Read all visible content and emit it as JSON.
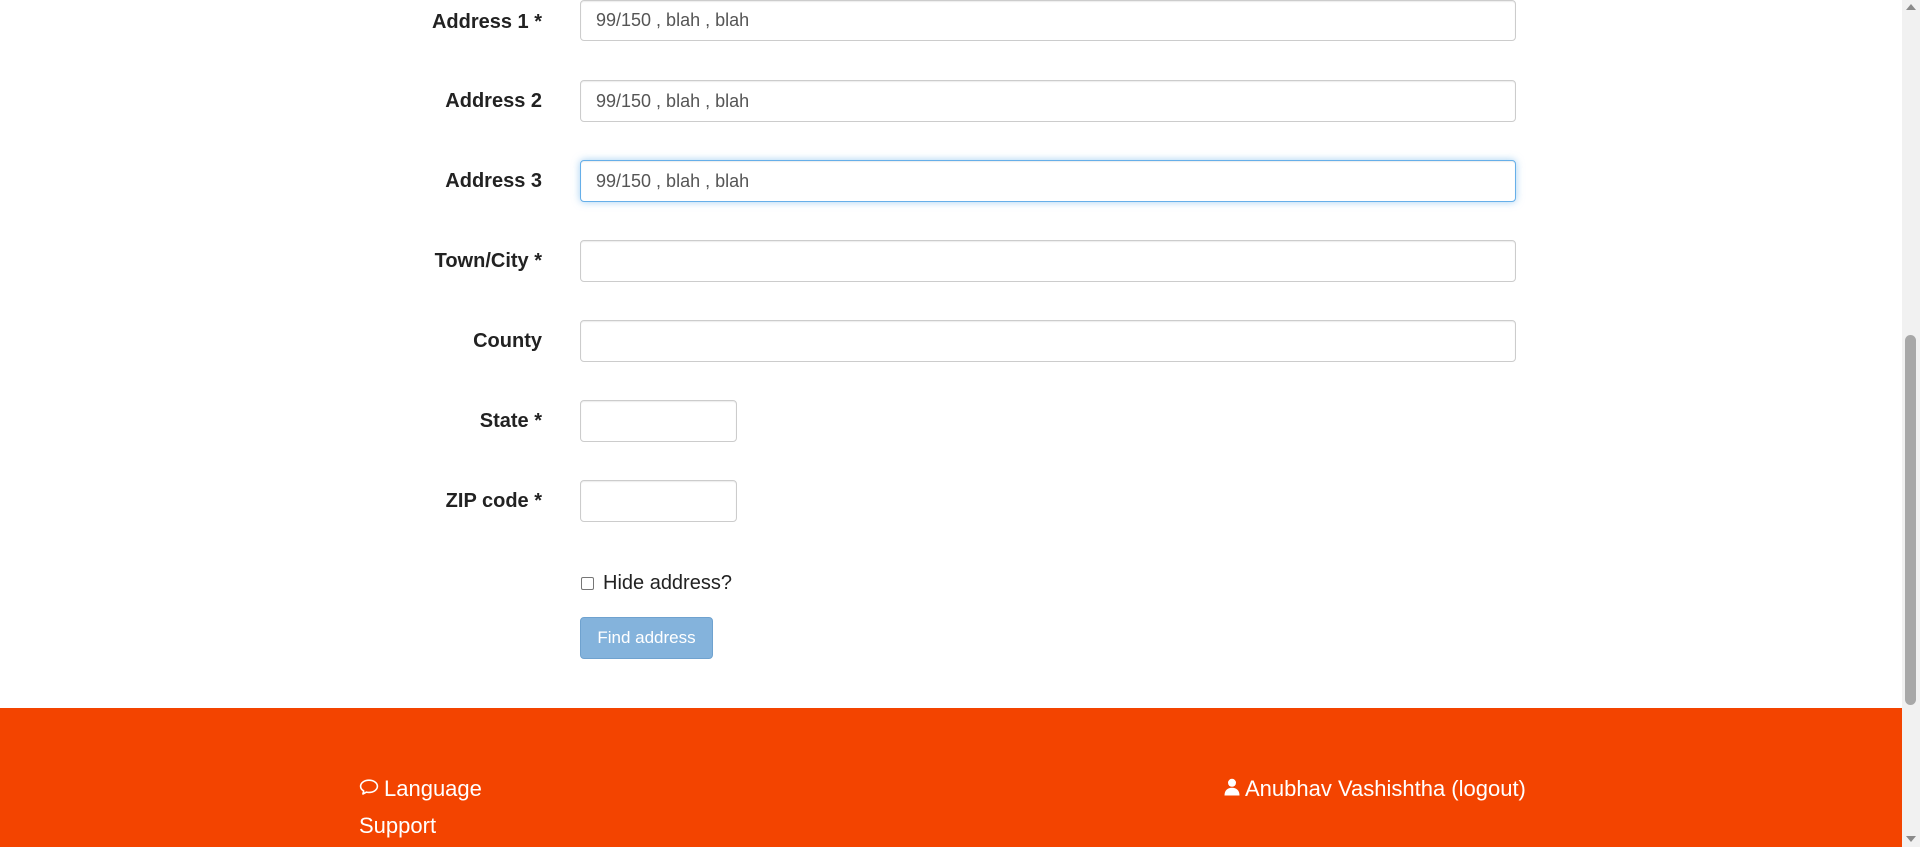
{
  "form": {
    "address1": {
      "label": "Address 1 *",
      "value": "99/150 , blah , blah"
    },
    "address2": {
      "label": "Address 2",
      "value": "99/150 , blah , blah"
    },
    "address3": {
      "label": "Address 3",
      "value": "99/150 , blah , blah"
    },
    "town_city": {
      "label": "Town/City *",
      "value": ""
    },
    "county": {
      "label": "County",
      "value": ""
    },
    "state": {
      "label": "State *",
      "value": ""
    },
    "zip_code": {
      "label": "ZIP code *",
      "value": ""
    },
    "hide_address": {
      "label": "Hide address?",
      "checked": false
    },
    "find_address_label": "Find address"
  },
  "footer": {
    "language_label": "Language",
    "support_label": "Support",
    "user_label": "Anubhav Vashishtha (logout)"
  },
  "colors": {
    "footer_bg": "#f34400",
    "button_bg": "#84b3dc",
    "focus_border": "#66afe9"
  },
  "icons": {
    "language": "speech-bubble-icon",
    "user": "user-icon"
  }
}
